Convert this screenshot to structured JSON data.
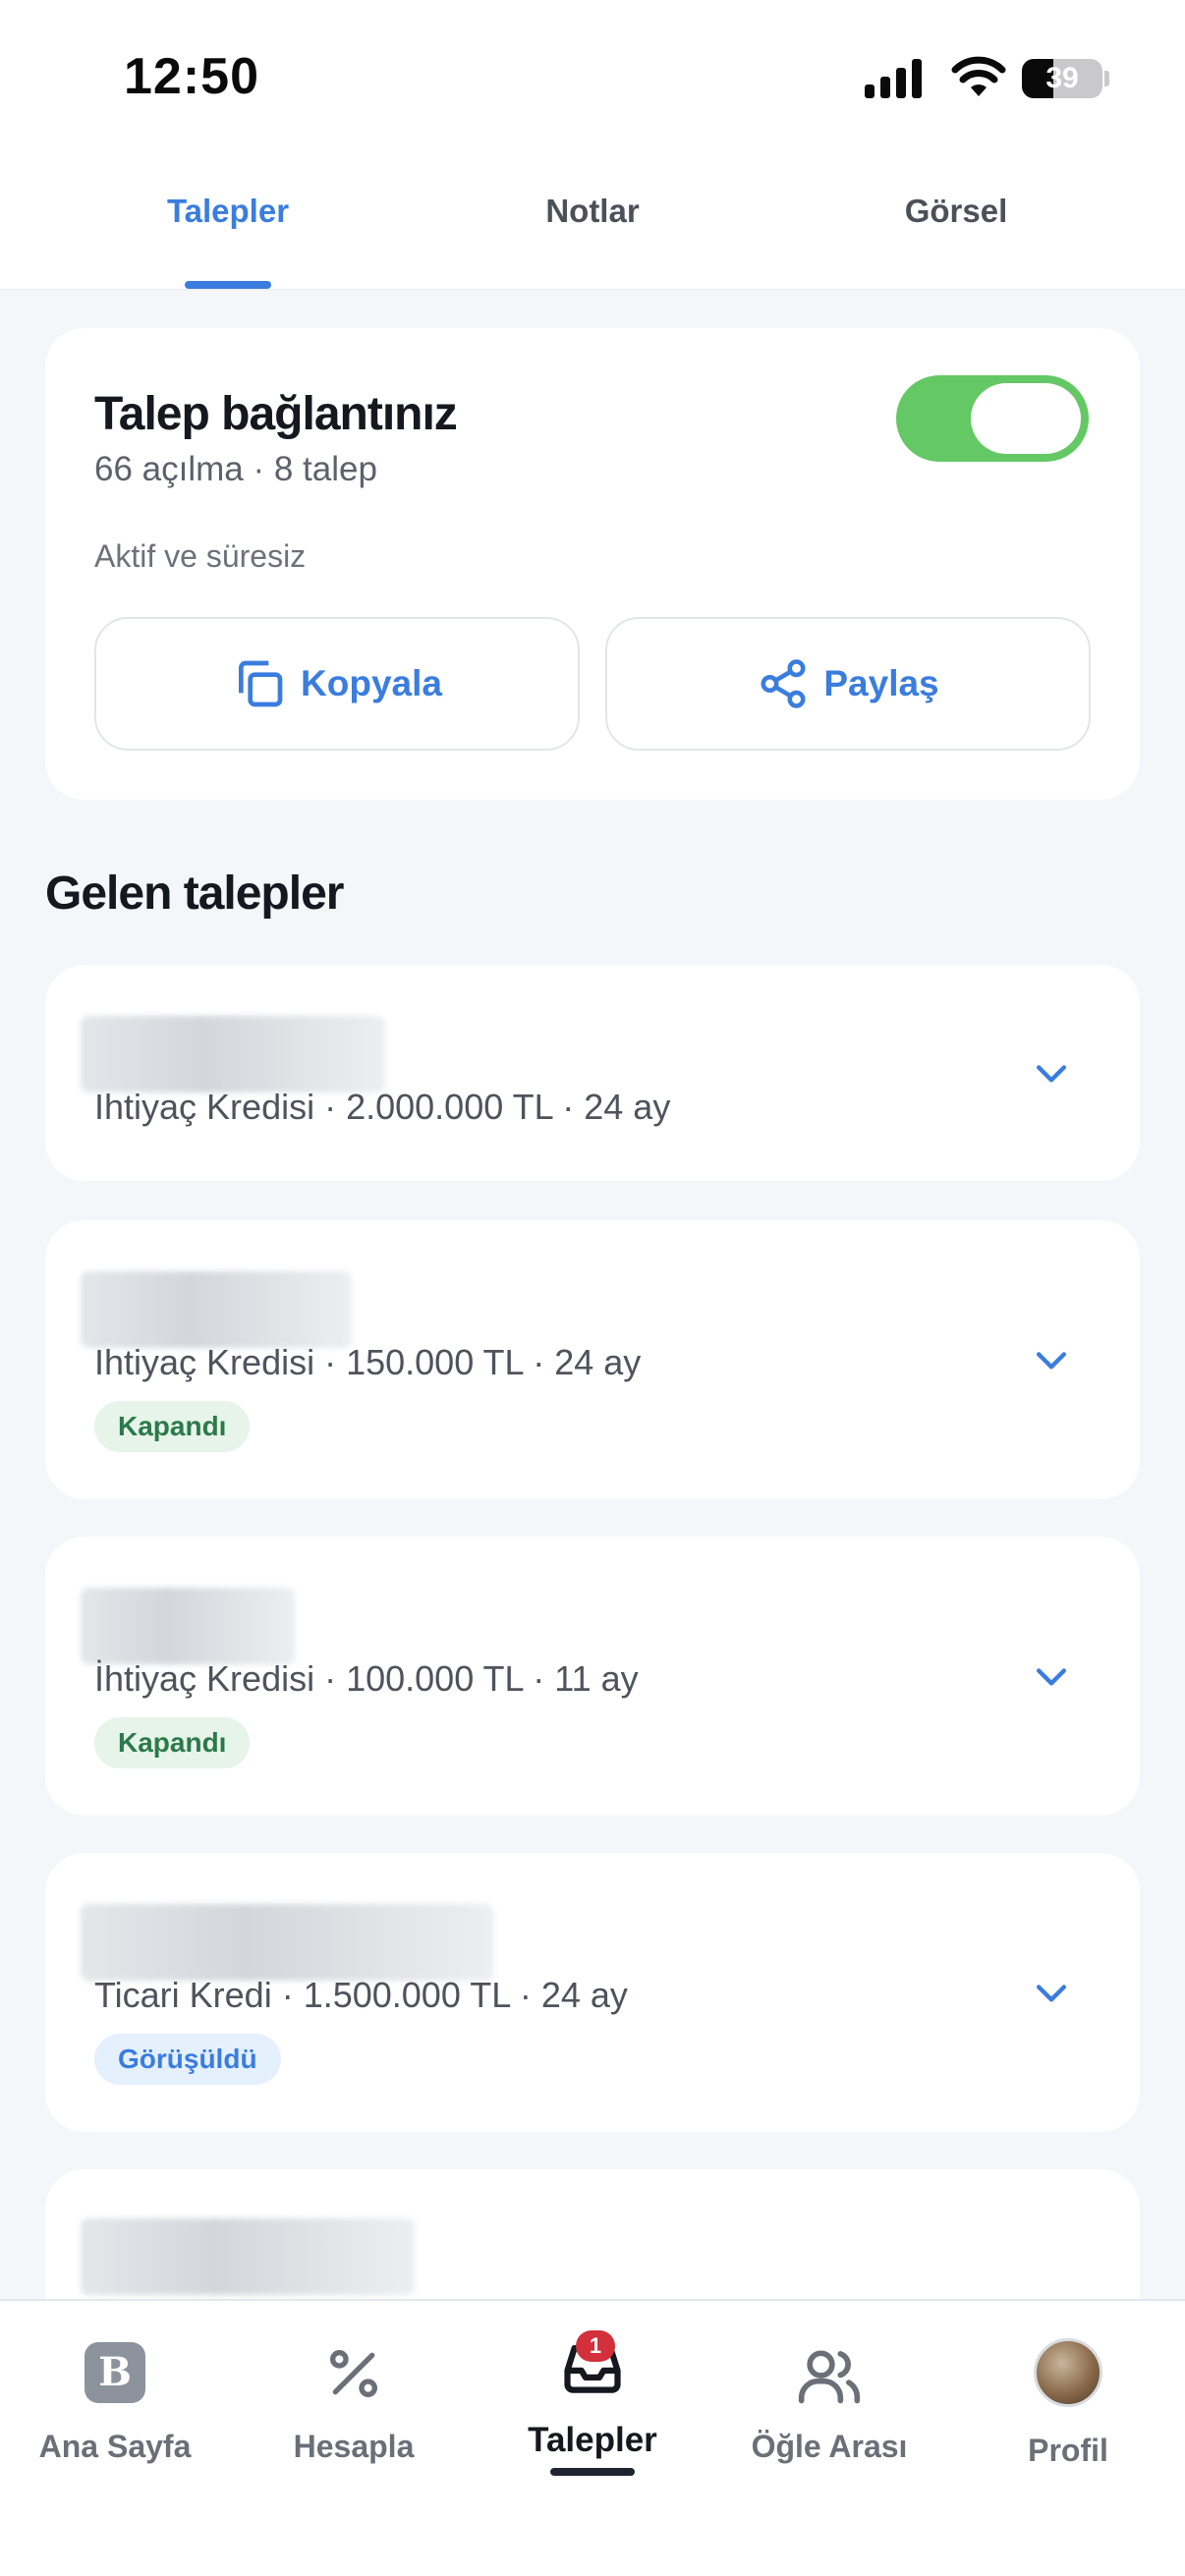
{
  "status_bar": {
    "time": "12:50",
    "battery": "39",
    "battery_level_percent": 39
  },
  "tabs": [
    {
      "label": "Talepler",
      "active": true
    },
    {
      "label": "Notlar",
      "active": false
    },
    {
      "label": "Görsel",
      "active": false
    }
  ],
  "link_card": {
    "title": "Talep bağlantınız",
    "stats": "66 açılma · 8 talep",
    "status": "Aktif ve süresiz",
    "toggle_on": true,
    "copy_label": "Kopyala",
    "share_label": "Paylaş"
  },
  "section_title": "Gelen talepler",
  "requests": [
    {
      "meta": "Ihtiyaç Kredisi · 2.000.000 TL · 24 ay",
      "badge": ""
    },
    {
      "meta": "Ihtiyaç Kredisi · 150.000 TL · 24 ay",
      "badge": "Kapandı"
    },
    {
      "meta": "İhtiyaç Kredisi · 100.000 TL · 11 ay",
      "badge": "Kapandı"
    },
    {
      "meta": "Ticari Kredi · 1.500.000 TL · 24 ay",
      "badge": "Görüşüldü"
    }
  ],
  "bottom_nav": [
    {
      "label": "Ana Sayfa",
      "icon": "home-logo-icon"
    },
    {
      "label": "Hesapla",
      "icon": "percent-icon"
    },
    {
      "label": "Talepler",
      "icon": "inbox-icon",
      "active": true,
      "badge": "1"
    },
    {
      "label": "Öğle Arası",
      "icon": "users-icon"
    },
    {
      "label": "Profil",
      "icon": "avatar-icon"
    }
  ],
  "colors": {
    "accent": "#3a7ddf",
    "toggle": "#64c964",
    "badge_red": "#d2303a"
  }
}
